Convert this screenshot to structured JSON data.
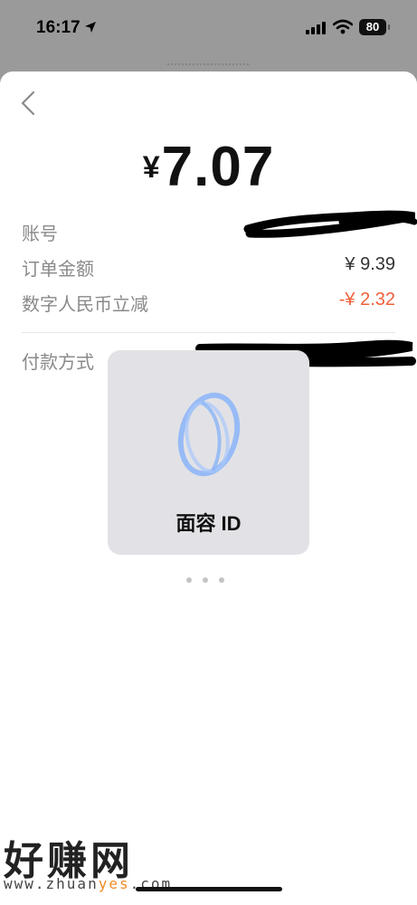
{
  "status": {
    "time": "16:17",
    "battery": "80"
  },
  "payment": {
    "currency_symbol": "¥",
    "amount": "7.07",
    "rows": [
      {
        "label": "账号",
        "value": ""
      },
      {
        "label": "订单金额",
        "value": "¥ 9.39"
      },
      {
        "label": "数字人民币立减",
        "value": "-¥ 2.32"
      }
    ],
    "method_label": "付款方式"
  },
  "faceid": {
    "label": "面容 ID"
  },
  "watermark": {
    "text": "好赚网",
    "url_prefix": "www.zhuan",
    "url_accent": "yes",
    "url_suffix": ".com"
  },
  "colors": {
    "discount": "#f0603a",
    "faceid_blue": "#8ab4f8",
    "watermark_accent": "#f08a24"
  },
  "icons": [
    "location-arrow-icon",
    "cellular-signal-icon",
    "wifi-icon",
    "battery-icon",
    "back-chevron-icon",
    "face-id-icon"
  ]
}
